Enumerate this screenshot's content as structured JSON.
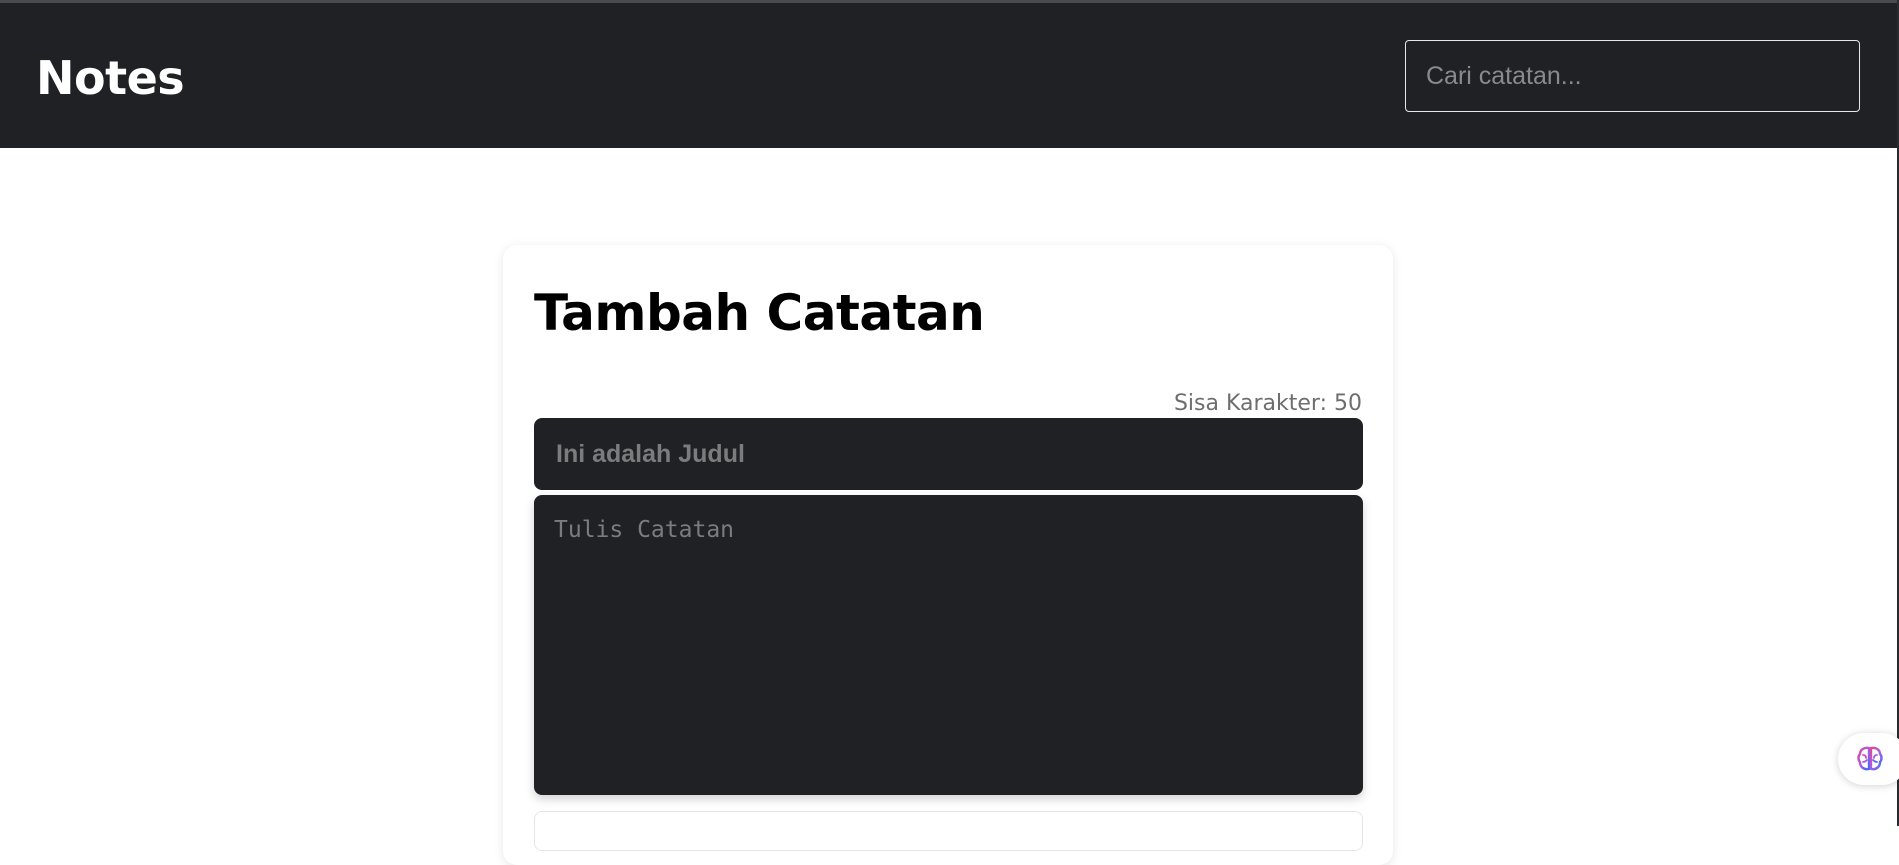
{
  "header": {
    "brand": "Notes",
    "search_placeholder": "Cari catatan..."
  },
  "note_form": {
    "title": "Tambah Catatan",
    "char_counter": "Sisa Karakter: 50",
    "title_placeholder": "Ini adalah Judul",
    "body_placeholder": "Tulis Catatan"
  },
  "colors": {
    "header_bg": "#202124",
    "input_bg": "#202124",
    "card_bg": "#ffffff",
    "text_primary": "#000000",
    "text_muted": "#6e6e6e"
  },
  "icons": {
    "ai_assistant": "brain-icon"
  }
}
